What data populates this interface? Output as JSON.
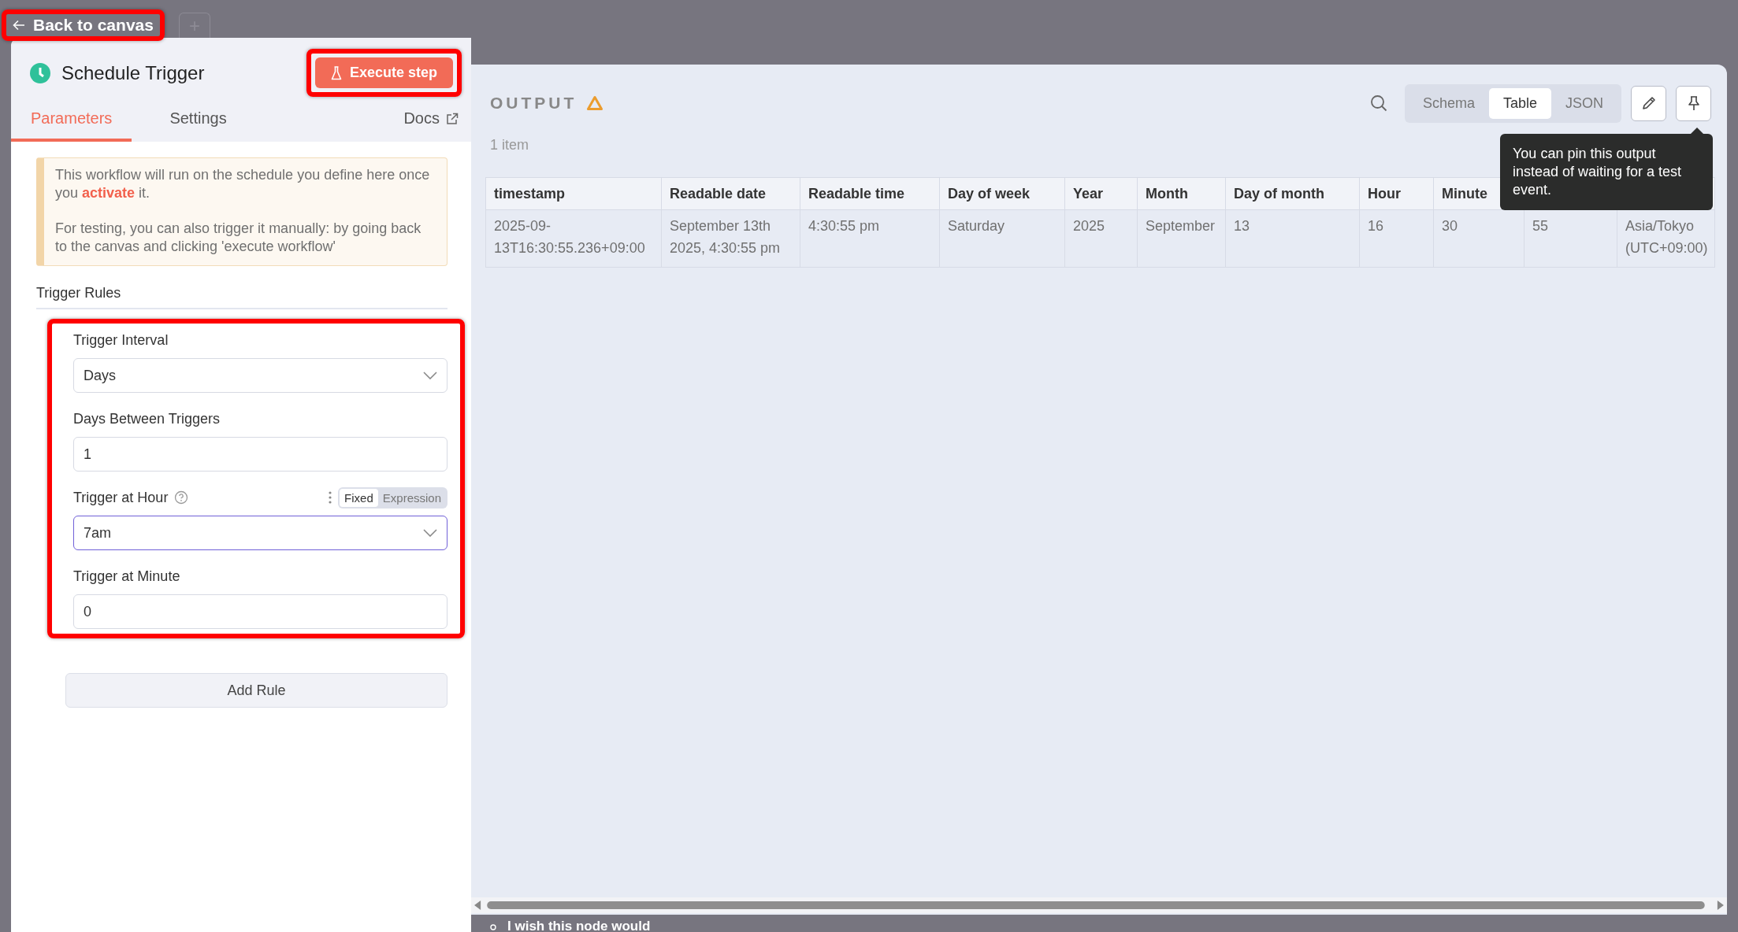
{
  "back_button": {
    "label": "Back to canvas"
  },
  "new_tab_button": {
    "label": "+"
  },
  "node_panel": {
    "title": "Schedule Trigger",
    "execute_button": "Execute step",
    "tabs": [
      {
        "label": "Parameters",
        "selected": true
      },
      {
        "label": "Settings",
        "selected": false
      }
    ],
    "docs_link": "Docs",
    "notice": [
      "This workflow will run on the schedule you define here once you **activate** it.",
      "For testing, you can also trigger it manually: by going back to the canvas and clicking 'execute workflow'"
    ],
    "section_title": "Trigger Rules",
    "fields": [
      {
        "kind": "select",
        "label": "Trigger Interval",
        "value": "Days",
        "focused": false
      },
      {
        "kind": "input",
        "label": "Days Between Triggers",
        "value": "1",
        "focused": false
      },
      {
        "kind": "select",
        "label": "Trigger at Hour",
        "value": "7am",
        "focused": true,
        "help": true,
        "mode_toggle": [
          {
            "label": "Fixed",
            "selected": true
          },
          {
            "label": "Expression",
            "selected": false
          }
        ]
      },
      {
        "kind": "input",
        "label": "Trigger at Minute",
        "value": "0",
        "focused": false
      }
    ],
    "add_rule_button": "Add Rule"
  },
  "output_panel": {
    "title": "OUTPUT",
    "item_count": "1 item",
    "view_modes": [
      {
        "label": "Schema",
        "selected": false
      },
      {
        "label": "Table",
        "selected": true
      },
      {
        "label": "JSON",
        "selected": false
      }
    ],
    "tooltip": "You can pin this output instead of waiting for a test event.",
    "table": {
      "columns": [
        "timestamp",
        "Readable date",
        "Readable time",
        "Day of week",
        "Year",
        "Month",
        "Day of month",
        "Hour",
        "Minute"
      ],
      "rows": [
        [
          "2025-09-13T16:30:55.236+09:00",
          "September 13th 2025, 4:30:55 pm",
          "4:30:55 pm",
          "Saturday",
          "2025",
          "September",
          "13",
          "16",
          "30",
          "55",
          "Asia/Tokyo (UTC+09:00)"
        ]
      ]
    }
  },
  "footer": {
    "text": "I wish this node would"
  }
}
